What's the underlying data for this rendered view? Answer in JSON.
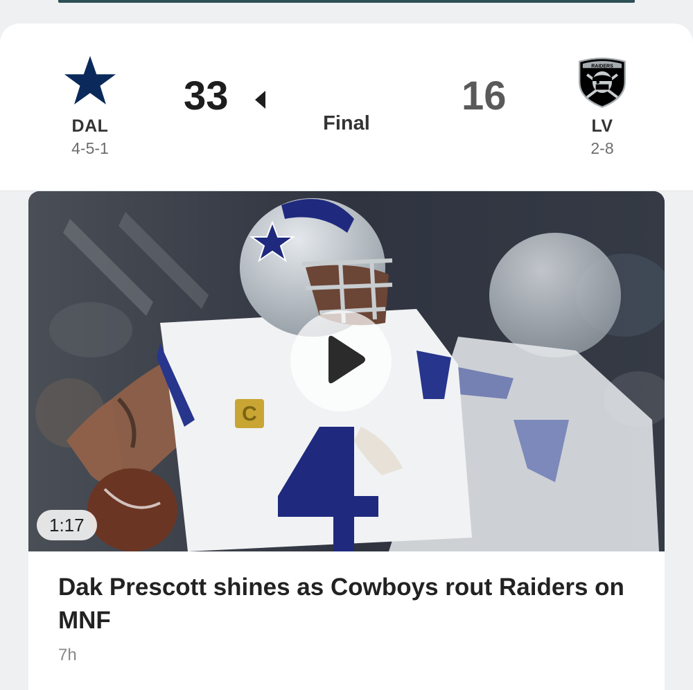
{
  "game": {
    "home": {
      "abbr": "DAL",
      "record": "4-5-1",
      "score": "33",
      "logo": "dallas-star-icon",
      "color": "#0b2a5b"
    },
    "away": {
      "abbr": "LV",
      "record": "2-8",
      "score": "16",
      "logo": "raiders-shield-icon",
      "shield_text": "RAIDERS",
      "color": "#000000"
    },
    "status": "Final",
    "winner": "home"
  },
  "story": {
    "duration": "1:17",
    "headline": "Dak Prescott shines as Cowboys rout Raiders on MNF",
    "time": "7h",
    "icon": "play-icon"
  }
}
